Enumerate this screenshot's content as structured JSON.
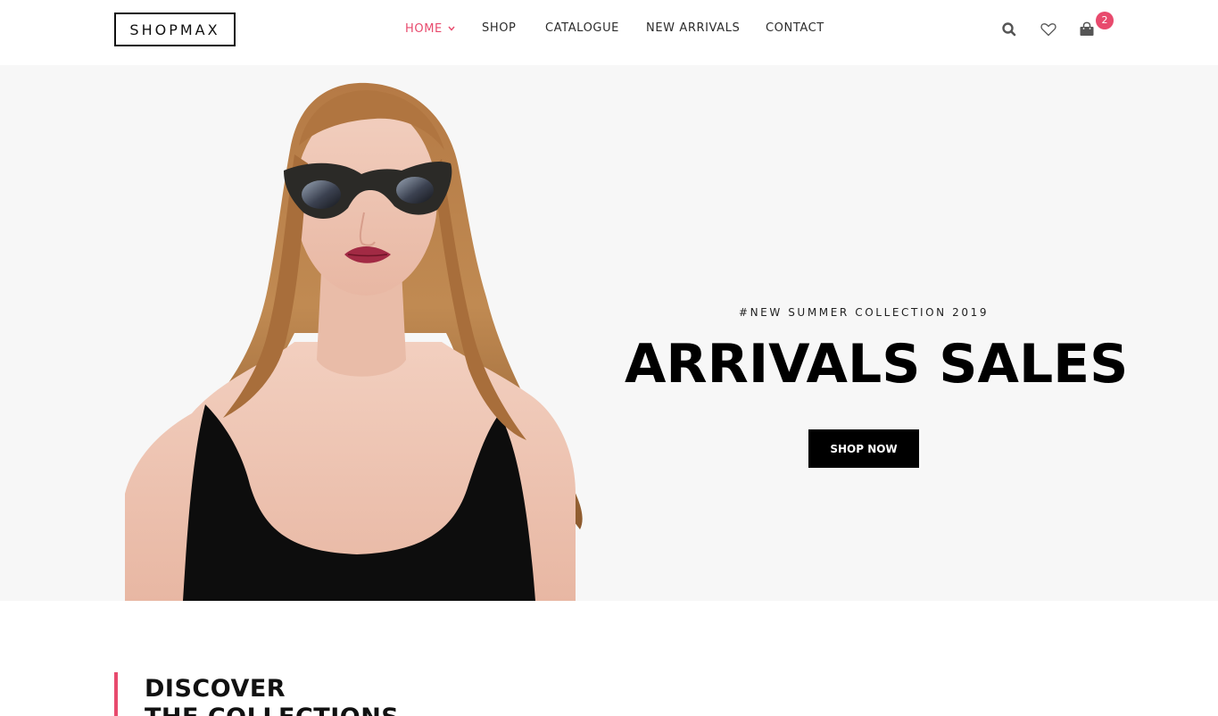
{
  "brand": {
    "logo_text": "SHOPMAX"
  },
  "nav": {
    "items": [
      {
        "label": "HOME",
        "active": true,
        "has_dropdown": true
      },
      {
        "label": "SHOP"
      },
      {
        "label": "CATALOGUE"
      },
      {
        "label": "NEW ARRIVALS"
      },
      {
        "label": "CONTACT"
      }
    ]
  },
  "header_icons": {
    "search": "search-icon",
    "wishlist": "heart-icon",
    "cart": "shopping-bag-icon",
    "cart_count": "2"
  },
  "hero": {
    "tag": "#NEW SUMMER COLLECTION 2019",
    "title": "ARRIVALS SALES",
    "button_label": "SHOP NOW"
  },
  "discover": {
    "line1": "DISCOVER",
    "line2": "THE COLLECTIONS"
  },
  "colors": {
    "accent": "#e84a6d",
    "hero_bg": "#f7f7f7",
    "button_bg": "#000000"
  }
}
